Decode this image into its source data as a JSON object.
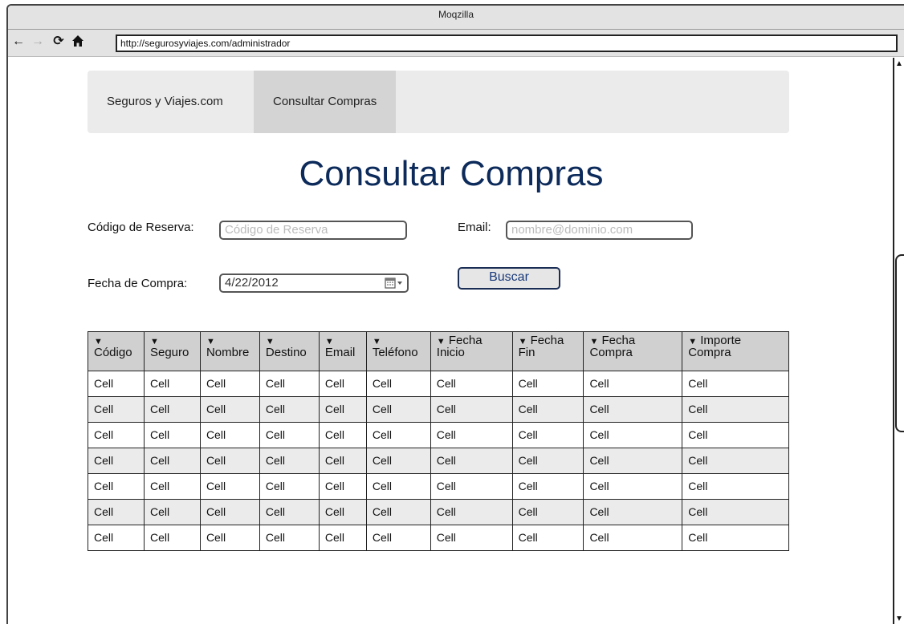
{
  "browser": {
    "title": "Moqzilla",
    "url": "http://segurosyviajes.com/administrador",
    "icons": [
      "back-arrow-icon",
      "forward-arrow-icon",
      "reload-icon",
      "home-icon"
    ]
  },
  "menu": {
    "brand": "Seguros y Viajes.com",
    "active_item": "Consultar Compras"
  },
  "page": {
    "title": "Consultar Compras"
  },
  "form": {
    "codigo_label": "Código de Reserva:",
    "codigo_placeholder": "Código de Reserva",
    "email_label": "Email:",
    "email_placeholder": "nombre@dominio.com",
    "fecha_label": "Fecha de Compra:",
    "fecha_value": "4/22/2012",
    "search_label": "Buscar"
  },
  "table": {
    "sort_glyph": "▼",
    "headers": [
      [
        "Código"
      ],
      [
        "Seguro"
      ],
      [
        "Nombre"
      ],
      [
        "Destino"
      ],
      [
        "Email"
      ],
      [
        "Teléfono"
      ],
      [
        "Fecha",
        "Inicio"
      ],
      [
        "Fecha",
        "Fin"
      ],
      [
        "Fecha",
        "Compra"
      ],
      [
        "Importe",
        "Compra"
      ]
    ],
    "rows": [
      [
        "Cell",
        "Cell",
        "Cell",
        "Cell",
        "Cell",
        "Cell",
        "Cell",
        "Cell",
        "Cell",
        "Cell"
      ],
      [
        "Cell",
        "Cell",
        "Cell",
        "Cell",
        "Cell",
        "Cell",
        "Cell",
        "Cell",
        "Cell",
        "Cell"
      ],
      [
        "Cell",
        "Cell",
        "Cell",
        "Cell",
        "Cell",
        "Cell",
        "Cell",
        "Cell",
        "Cell",
        "Cell"
      ],
      [
        "Cell",
        "Cell",
        "Cell",
        "Cell",
        "Cell",
        "Cell",
        "Cell",
        "Cell",
        "Cell",
        "Cell"
      ],
      [
        "Cell",
        "Cell",
        "Cell",
        "Cell",
        "Cell",
        "Cell",
        "Cell",
        "Cell",
        "Cell",
        "Cell"
      ],
      [
        "Cell",
        "Cell",
        "Cell",
        "Cell",
        "Cell",
        "Cell",
        "Cell",
        "Cell",
        "Cell",
        "Cell"
      ],
      [
        "Cell",
        "Cell",
        "Cell",
        "Cell",
        "Cell",
        "Cell",
        "Cell",
        "Cell",
        "Cell",
        "Cell"
      ]
    ]
  },
  "colors": {
    "title": "#0c2a5a",
    "button_text": "#1a3a7a",
    "menu_bg": "#ebebeb",
    "menu_active_bg": "#d4d4d4",
    "header_bg": "#d0d0d0"
  }
}
